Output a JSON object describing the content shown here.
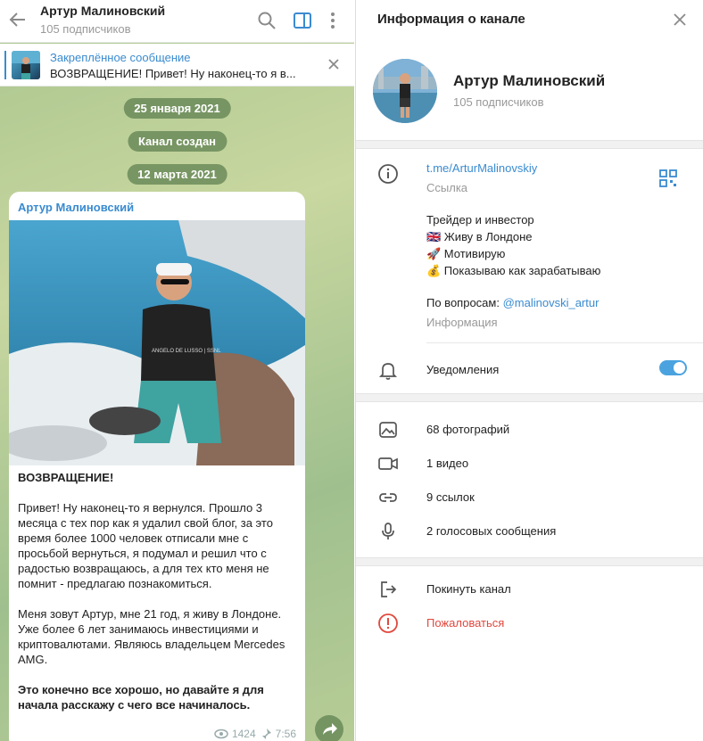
{
  "chat": {
    "title": "Артур Малиновский",
    "subtitle": "105 подписчиков",
    "pinned": {
      "title": "Закреплённое сообщение",
      "text": "ВОЗВРАЩЕНИЕ!  Привет! Ну наконец-то я в..."
    },
    "dates": [
      "25 января 2021",
      "Канал создан",
      "12 марта 2021"
    ],
    "message": {
      "author": "Артур Малиновский",
      "heading": "ВОЗВРАЩЕНИЕ!",
      "p1": "Привет! Ну наконец-то я вернулся. Прошло 3 месяца с тех пор как я удалил свой блог, за это время более 1000 человек отписали мне с просьбой вернуться, я подумал и решил что с радостью возвращаюсь, а для тех кто меня не помнит - предлагаю познакомиться.",
      "p2": "Меня зовут Артур, мне 21 год, я живу в Лондоне. Уже более 6 лет занимаюсь инвестициями и криптовалютами. Являюсь владельцем Mercedes AMG.",
      "p3": "Это конечно все хорошо, но давайте я для начала расскажу с чего все начиналось.",
      "views": "1424",
      "time": "7:56",
      "photo_shirt_text": "ANGELO DE LUSSO | SSNL"
    }
  },
  "info": {
    "title": "Информация о канале",
    "channel_name": "Артур Малиновский",
    "subscribers": "105 подписчиков",
    "link": "t.me/ArturMalinovskiy",
    "link_label": "Ссылка",
    "description": [
      "Трейдер и инвестор",
      "🇬🇧 Живу в Лондоне",
      "🚀 Мотивирую",
      "💰 Показываю как зарабатываю"
    ],
    "contact_prefix": "По вопросам: ",
    "contact_handle": "@malinovski_artur",
    "info_label": "Информация",
    "notifications": "Уведомления",
    "notifications_on": true,
    "media": {
      "photos": "68 фотографий",
      "videos": "1 видео",
      "links": "9 ссылок",
      "voice": "2 голосовых сообщения"
    },
    "leave": "Покинуть канал",
    "report": "Пожаловаться"
  },
  "colors": {
    "accent": "#3a8bd0",
    "danger": "#e0483e",
    "toggle": "#4aa3df"
  }
}
